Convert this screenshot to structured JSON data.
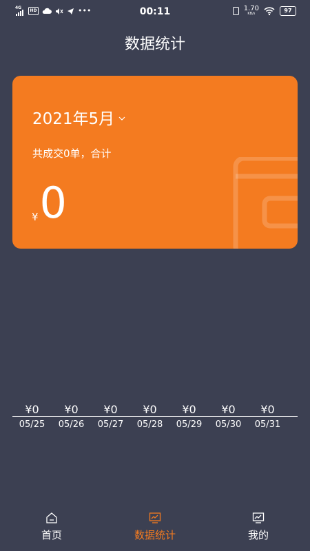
{
  "status_bar": {
    "network": "4G",
    "hd": "HD",
    "time": "00:11",
    "speed_value": "1.70",
    "speed_unit": "KB/s",
    "battery": "97"
  },
  "header": {
    "title": "数据统计"
  },
  "card": {
    "month": "2021年5月",
    "summary": "共成交0单，合计",
    "currency": "¥",
    "total": "0"
  },
  "daily": [
    {
      "date": "05/25",
      "amount": "¥0"
    },
    {
      "date": "05/26",
      "amount": "¥0"
    },
    {
      "date": "05/27",
      "amount": "¥0"
    },
    {
      "date": "05/28",
      "amount": "¥0"
    },
    {
      "date": "05/29",
      "amount": "¥0"
    },
    {
      "date": "05/30",
      "amount": "¥0"
    },
    {
      "date": "05/31",
      "amount": "¥0"
    }
  ],
  "tabs": [
    {
      "label": "首页",
      "icon": "home-icon",
      "active": false
    },
    {
      "label": "数据统计",
      "icon": "monitor-chart-icon",
      "active": true
    },
    {
      "label": "我的",
      "icon": "chart-icon",
      "active": false
    }
  ],
  "colors": {
    "background": "#3c4052",
    "accent": "#f47b20"
  }
}
